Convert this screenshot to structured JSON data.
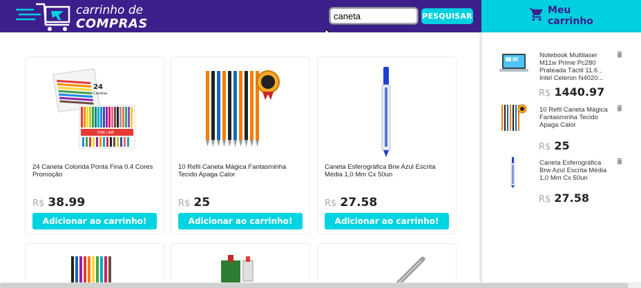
{
  "header": {
    "logo_line1": "carrinho de",
    "logo_line2": "COMPRAS",
    "search": {
      "value": "caneta",
      "placeholder": ""
    },
    "search_button": "PESQUISAR"
  },
  "cart": {
    "title_line1": "Meu",
    "title_line2": "carrinho",
    "currency": "R$",
    "items": [
      {
        "name": "Notebook Multilaser M11w Prime Pc280 Prateada Táctil 11.6 , Intel Celeron N4020...",
        "price": "1440.97",
        "icon": "notebook-icon"
      },
      {
        "name": "10 Refil Caneta Mágica Fantasminha Tecido Apaga Calor",
        "price": "25",
        "icon": "refill-pens-icon"
      },
      {
        "name": "Caneta Esferográfica Brw Azul Escrita Média 1,0 Mm Cx 50un",
        "price": "27.58",
        "icon": "blue-pen-icon"
      }
    ]
  },
  "products": {
    "currency": "R$",
    "add_label": "Adicionar ao carrinho!",
    "items": [
      {
        "title": "24 Caneta Colorida Ponta Fina 0.4 Cores Promoção",
        "price": "38.99"
      },
      {
        "title": "10 Refil Caneta Mágica Fantasminha Tecido Apaga Calor",
        "price": "25"
      },
      {
        "title": "Caneta Esferográfica Brw Azul Escrita Média 1,0 Mm Cx 50un",
        "price": "27.58"
      }
    ]
  },
  "product_image_text": {
    "box_number": "24",
    "box_label": "Canetas",
    "box_brand": "FINE LINE"
  },
  "colors": {
    "header": "#3d1f8c",
    "accent": "#00cfe0",
    "button": "#00d4e2"
  }
}
